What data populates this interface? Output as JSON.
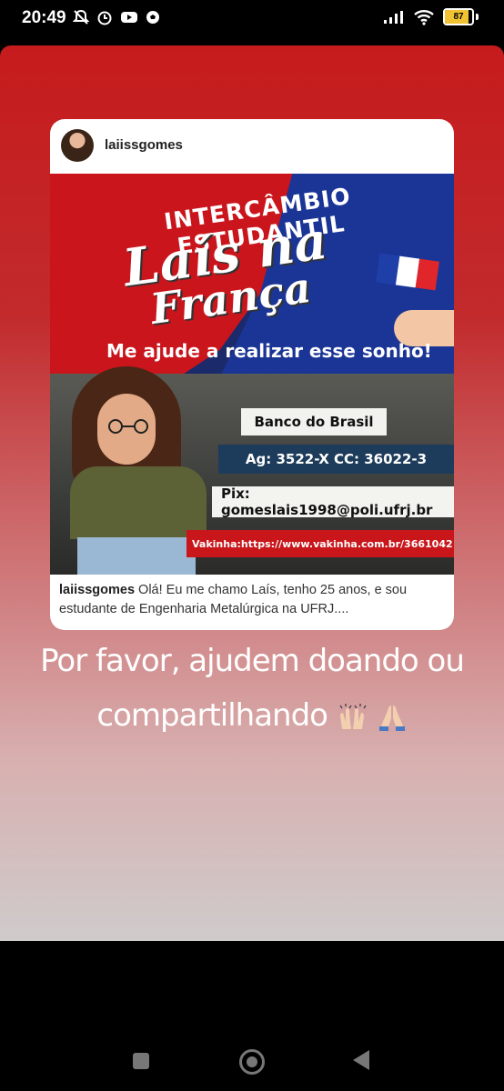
{
  "status_bar": {
    "time": "20:49",
    "battery": "87",
    "battery_level": 0.87,
    "left_icons": [
      "mute-icon",
      "alarm-icon",
      "youtube-icon",
      "soccer-icon"
    ],
    "right_icons": [
      "signal-icon",
      "wifi-icon",
      "battery-icon"
    ]
  },
  "shared_post": {
    "username": "laiissgomes",
    "image_text": {
      "headline": "INTERCÂMBIO ESTUDANTIL",
      "name": "Laís na",
      "country": "França",
      "subtitle": "Me ajude a realizar esse sonho!",
      "bank": "Banco do Brasil",
      "account": "Ag: 3522-X CC: 36022-3",
      "pix": "Pix: gomeslais1998@poli.ufrj.br",
      "vakinha": "Vakinha:https://www.vakinha.com.br/3661042"
    },
    "caption_user": "laiissgomes",
    "caption_text": "Olá! Eu me chamo Laís, tenho 25 anos, e sou estudante de Engenharia Metalúrgica na UFRJ...."
  },
  "story_text": {
    "line1": "Por favor, ajudem doando ou",
    "line2": "compartilhando"
  },
  "colors": {
    "story_top": "#c61b1d",
    "story_bottom": "#cfcbcb",
    "flag_blue": "#1f3fa8",
    "flag_red": "#e0262b"
  },
  "nav": [
    "recents-button",
    "home-button",
    "back-button"
  ]
}
